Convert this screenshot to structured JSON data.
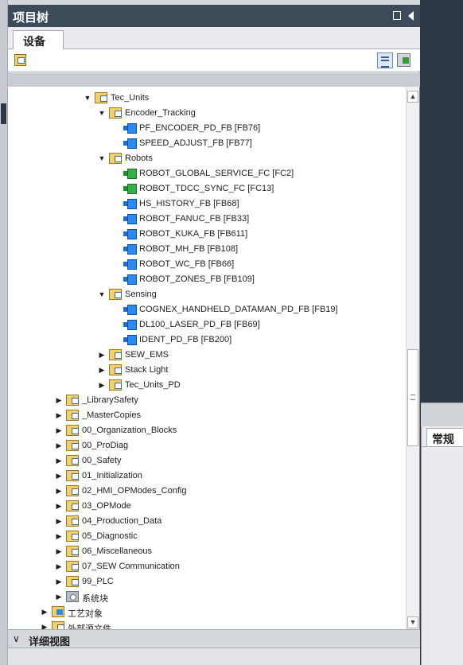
{
  "panel": {
    "title": "项目树",
    "tab_devices": "设备"
  },
  "tree": [
    {
      "label": "Tec_Units",
      "kind": "folder",
      "depth": 0,
      "state": "expanded"
    },
    {
      "label": "Encoder_Tracking",
      "kind": "folder",
      "depth": 1,
      "state": "expanded"
    },
    {
      "label": "PF_ENCODER_PD_FB [FB76]",
      "kind": "fb",
      "depth": 2,
      "state": "leaf"
    },
    {
      "label": "SPEED_ADJUST_FB [FB77]",
      "kind": "fb",
      "depth": 2,
      "state": "leaf"
    },
    {
      "label": "Robots",
      "kind": "folder",
      "depth": 1,
      "state": "expanded"
    },
    {
      "label": "ROBOT_GLOBAL_SERVICE_FC [FC2]",
      "kind": "fc",
      "depth": 2,
      "state": "leaf"
    },
    {
      "label": "ROBOT_TDCC_SYNC_FC [FC13]",
      "kind": "fc",
      "depth": 2,
      "state": "leaf"
    },
    {
      "label": "HS_HISTORY_FB [FB68]",
      "kind": "fb",
      "depth": 2,
      "state": "leaf"
    },
    {
      "label": "ROBOT_FANUC_FB [FB33]",
      "kind": "fb",
      "depth": 2,
      "state": "leaf"
    },
    {
      "label": "ROBOT_KUKA_FB [FB611]",
      "kind": "fb",
      "depth": 2,
      "state": "leaf"
    },
    {
      "label": "ROBOT_MH_FB [FB108]",
      "kind": "fb",
      "depth": 2,
      "state": "leaf"
    },
    {
      "label": "ROBOT_WC_FB [FB66]",
      "kind": "fb",
      "depth": 2,
      "state": "leaf"
    },
    {
      "label": "ROBOT_ZONES_FB [FB109]",
      "kind": "fb",
      "depth": 2,
      "state": "leaf"
    },
    {
      "label": "Sensing",
      "kind": "folder",
      "depth": 1,
      "state": "expanded"
    },
    {
      "label": "COGNEX_HANDHELD_DATAMAN_PD_FB [FB19]",
      "kind": "fb",
      "depth": 2,
      "state": "leaf"
    },
    {
      "label": "DL100_LASER_PD_FB [FB69]",
      "kind": "fb",
      "depth": 2,
      "state": "leaf"
    },
    {
      "label": "IDENT_PD_FB [FB200]",
      "kind": "fb",
      "depth": 2,
      "state": "leaf"
    },
    {
      "label": "SEW_EMS",
      "kind": "folder",
      "depth": 1,
      "state": "collapsed"
    },
    {
      "label": "Stack Light",
      "kind": "folder",
      "depth": 1,
      "state": "collapsed"
    },
    {
      "label": "Tec_Units_PD",
      "kind": "folder",
      "depth": 1,
      "state": "collapsed"
    },
    {
      "label": "_LibrarySafety",
      "kind": "folder",
      "depth": -2,
      "state": "collapsed"
    },
    {
      "label": "_MasterCopies",
      "kind": "folder",
      "depth": -2,
      "state": "collapsed"
    },
    {
      "label": "00_Organization_Blocks",
      "kind": "folder",
      "depth": -2,
      "state": "collapsed"
    },
    {
      "label": "00_ProDiag",
      "kind": "folder",
      "depth": -2,
      "state": "collapsed"
    },
    {
      "label": "00_Safety",
      "kind": "folder",
      "depth": -2,
      "state": "collapsed"
    },
    {
      "label": "01_Initialization",
      "kind": "folder",
      "depth": -2,
      "state": "collapsed"
    },
    {
      "label": "02_HMI_OPModes_Config",
      "kind": "folder",
      "depth": -2,
      "state": "collapsed"
    },
    {
      "label": "03_OPMode",
      "kind": "folder",
      "depth": -2,
      "state": "collapsed"
    },
    {
      "label": "04_Production_Data",
      "kind": "folder",
      "depth": -2,
      "state": "collapsed"
    },
    {
      "label": "05_Diagnostic",
      "kind": "folder",
      "depth": -2,
      "state": "collapsed"
    },
    {
      "label": "06_Miscellaneous",
      "kind": "folder",
      "depth": -2,
      "state": "collapsed"
    },
    {
      "label": "07_SEW Communication",
      "kind": "folder",
      "depth": -2,
      "state": "collapsed"
    },
    {
      "label": "99_PLC",
      "kind": "folder",
      "depth": -2,
      "state": "collapsed"
    },
    {
      "label": "系统块",
      "kind": "sys",
      "depth": -2,
      "state": "collapsed"
    },
    {
      "label": "工艺对象",
      "kind": "tech",
      "depth": -3,
      "state": "collapsed"
    },
    {
      "label": "外部源文件",
      "kind": "ext",
      "depth": -3,
      "state": "collapsed"
    }
  ],
  "details": {
    "label": "详细视图"
  },
  "properties": {
    "tab_general": "常规"
  },
  "icons": {
    "toolbar_left": "add-group-icon",
    "toolbar_view": "list-view-icon",
    "toolbar_save": "save-layout-icon",
    "collapse": "collapse-panel-icon"
  },
  "colors": {
    "title_bar": "#3c4a5a",
    "background_dark": "#2c3644",
    "fb_block": "#2b8af0",
    "fc_block": "#33b046",
    "folder": "#f4cf6a"
  }
}
